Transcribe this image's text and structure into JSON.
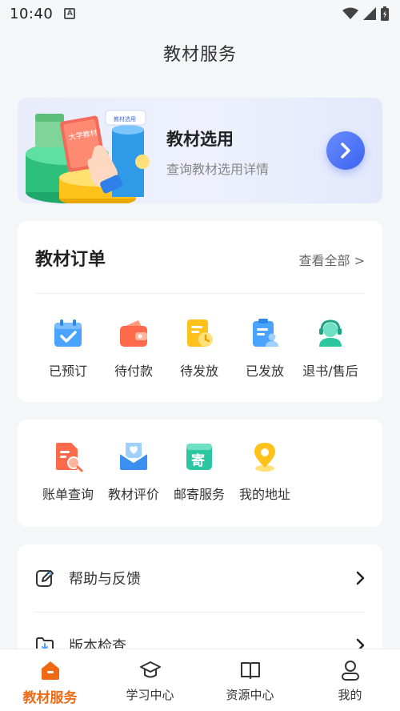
{
  "status_bar": {
    "time": "10:40",
    "notif_letter": "A"
  },
  "header": {
    "title": "教材服务"
  },
  "banner": {
    "title": "教材选用",
    "subtitle": "查询教材选用详情",
    "art_book_text": "大学教材",
    "art_tag_text": "教材选用"
  },
  "orders": {
    "title": "教材订单",
    "view_all": "查看全部 >",
    "items": [
      {
        "label": "已预订",
        "icon": "calendar-check-icon"
      },
      {
        "label": "待付款",
        "icon": "wallet-icon"
      },
      {
        "label": "待发放",
        "icon": "document-clock-icon"
      },
      {
        "label": "已发放",
        "icon": "document-person-icon"
      },
      {
        "label": "退书/售后",
        "icon": "headset-agent-icon"
      }
    ]
  },
  "services": {
    "items": [
      {
        "label": "账单查询",
        "icon": "bill-search-icon"
      },
      {
        "label": "教材评价",
        "icon": "heart-envelope-icon"
      },
      {
        "label": "邮寄服务",
        "icon": "mail-box-icon",
        "glyph": "寄"
      },
      {
        "label": "我的地址",
        "icon": "location-pin-icon"
      }
    ]
  },
  "settings": {
    "items": [
      {
        "label": "帮助与反馈",
        "icon": "edit-feedback-icon"
      },
      {
        "label": "版本检查",
        "icon": "folder-download-icon"
      }
    ]
  },
  "bottom_nav": {
    "items": [
      {
        "label": "教材服务",
        "icon": "home-icon",
        "active": true
      },
      {
        "label": "学习中心",
        "icon": "graduation-cap-icon",
        "active": false
      },
      {
        "label": "资源中心",
        "icon": "open-book-icon",
        "active": false
      },
      {
        "label": "我的",
        "icon": "user-icon",
        "active": false
      }
    ]
  },
  "colors": {
    "accent": "#f06a14",
    "banner_button": "#3a63f0"
  }
}
